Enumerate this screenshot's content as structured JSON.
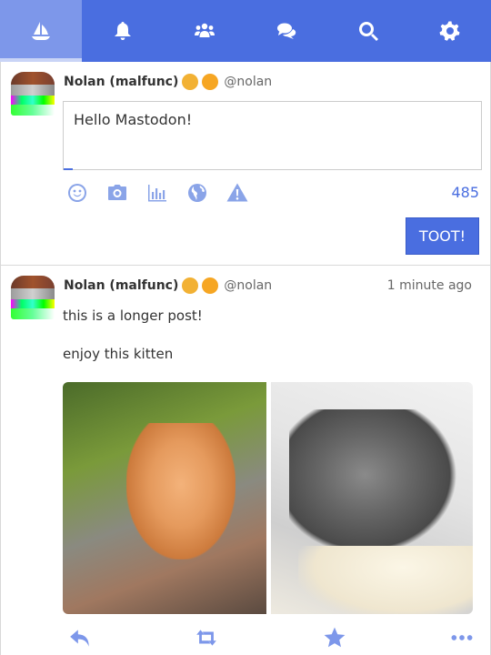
{
  "nav": {
    "items": [
      {
        "icon": "home-sailboat-icon",
        "active": true
      },
      {
        "icon": "bell-icon",
        "active": false
      },
      {
        "icon": "community-icon",
        "active": false
      },
      {
        "icon": "conversations-icon",
        "active": false
      },
      {
        "icon": "search-icon",
        "active": false
      },
      {
        "icon": "gear-icon",
        "active": false
      }
    ]
  },
  "compose": {
    "display_name": "Nolan (malfunc)",
    "handle": "@nolan",
    "text": "Hello Mastodon!",
    "char_count": "485",
    "toot_label": "TOOT!",
    "toolbar_icons": [
      "emoji-icon",
      "camera-icon",
      "poll-icon",
      "globe-icon",
      "warning-icon"
    ]
  },
  "status": {
    "display_name": "Nolan (malfunc)",
    "handle": "@nolan",
    "timestamp": "1 minute ago",
    "paragraphs": [
      "this is a longer post!",
      "enjoy this kitten"
    ],
    "actions": [
      "reply-icon",
      "boost-icon",
      "favorite-icon",
      "more-icon"
    ]
  },
  "colors": {
    "accent": "#4a6ee0",
    "nav_active": "#7d97ea",
    "icon_light": "#8aa4e8"
  }
}
